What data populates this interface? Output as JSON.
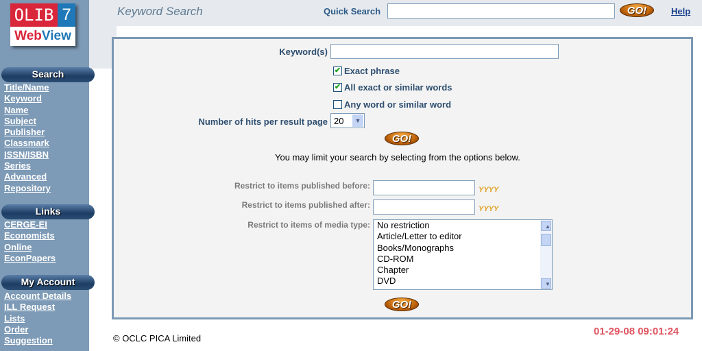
{
  "logo": {
    "line1": "OLIB",
    "num": "7",
    "web": "Web",
    "view": "View"
  },
  "header": {
    "title": "Keyword Search",
    "quick_search_label": "Quick Search",
    "quick_search_value": "",
    "go": "GO!",
    "help": "Help"
  },
  "sidebar": {
    "search": {
      "title": "Search",
      "items": [
        "Title/Name",
        "Keyword",
        "Name",
        "Subject",
        "Publisher",
        "Classmark",
        "ISSN/ISBN",
        "Series",
        "Advanced",
        "Repository"
      ]
    },
    "links": {
      "title": "Links",
      "items": [
        "CERGE-EI",
        "Economists",
        "Online",
        "EconPapers"
      ]
    },
    "account": {
      "title": "My Account",
      "items": [
        "Account Details",
        "ILL Request",
        "Lists",
        "Order",
        "Suggestion"
      ]
    }
  },
  "form": {
    "keyword_label": "Keyword(s)",
    "keyword_value": "",
    "options": [
      {
        "label": "Exact phrase",
        "checked": true
      },
      {
        "label": "All exact or similar words",
        "checked": true
      },
      {
        "label": "Any word or similar word",
        "checked": false
      }
    ],
    "hits_label": "Number of hits per result page",
    "hits_value": "20",
    "go": "GO!",
    "limit_text": "You may limit your search by selecting from the options below.",
    "before_label": "Restrict to items published before:",
    "after_label": "Restrict to items published after:",
    "yyyy": "YYYY",
    "media_label": "Restrict to items of media type:",
    "media_options": [
      "No restriction",
      "Article/Letter to editor",
      "Books/Monographs",
      "CD-ROM",
      "Chapter",
      "DVD"
    ]
  },
  "footer": {
    "copyright": "© OCLC PICA Limited",
    "datetime": "01-29-08 09:01:24"
  }
}
